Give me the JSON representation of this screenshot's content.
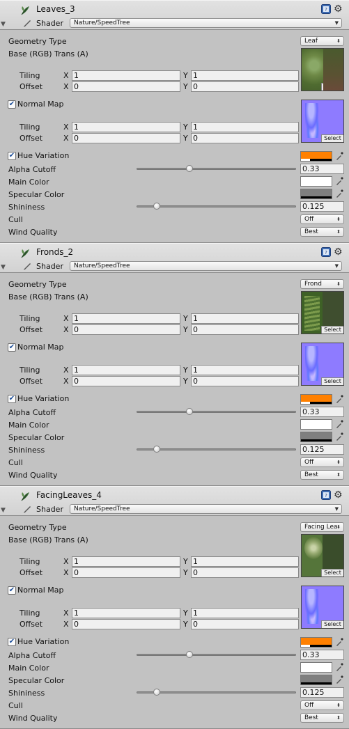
{
  "materials": [
    {
      "name": "Leaves_3",
      "shader_label": "Shader",
      "shader": "Nature/SpeedTree",
      "geometry_type_label": "Geometry Type",
      "geometry_type": "Leaf",
      "base_label": "Base (RGB) Trans (A)",
      "base_tiling": {
        "label": "Tiling",
        "x": "1",
        "y": "1"
      },
      "base_offset": {
        "label": "Offset",
        "x": "0",
        "y": "0"
      },
      "normal_map_label": "Normal Map",
      "normal_map_enabled": true,
      "normal_tiling": {
        "label": "Tiling",
        "x": "1",
        "y": "1"
      },
      "normal_offset": {
        "label": "Offset",
        "x": "0",
        "y": "0"
      },
      "hue_variation_label": "Hue Variation",
      "hue_variation_enabled": true,
      "hue_color": "#ff8000",
      "alpha_cutoff_label": "Alpha Cutoff",
      "alpha_cutoff": "0.33",
      "main_color_label": "Main Color",
      "main_color": "#ffffff",
      "specular_color_label": "Specular Color",
      "specular_color": "#7f7f7f",
      "shininess_label": "Shininess",
      "shininess": "0.125",
      "cull_label": "Cull",
      "cull": "Off",
      "wind_quality_label": "Wind Quality",
      "wind_quality": "Best",
      "select_label": "Select",
      "icons": {
        "material": "speedtree-leaf-icon",
        "help": "help-book-icon",
        "settings": "gear-icon",
        "shader": "pen-icon",
        "picker": "eyedropper-icon"
      }
    },
    {
      "name": "Fronds_2",
      "shader_label": "Shader",
      "shader": "Nature/SpeedTree",
      "geometry_type_label": "Geometry Type",
      "geometry_type": "Frond",
      "base_label": "Base (RGB) Trans (A)",
      "base_tiling": {
        "label": "Tiling",
        "x": "1",
        "y": "1"
      },
      "base_offset": {
        "label": "Offset",
        "x": "0",
        "y": "0"
      },
      "normal_map_label": "Normal Map",
      "normal_map_enabled": true,
      "normal_tiling": {
        "label": "Tiling",
        "x": "1",
        "y": "1"
      },
      "normal_offset": {
        "label": "Offset",
        "x": "0",
        "y": "0"
      },
      "hue_variation_label": "Hue Variation",
      "hue_variation_enabled": true,
      "hue_color": "#ff8000",
      "alpha_cutoff_label": "Alpha Cutoff",
      "alpha_cutoff": "0.33",
      "main_color_label": "Main Color",
      "main_color": "#ffffff",
      "specular_color_label": "Specular Color",
      "specular_color": "#7f7f7f",
      "shininess_label": "Shininess",
      "shininess": "0.125",
      "cull_label": "Cull",
      "cull": "Off",
      "wind_quality_label": "Wind Quality",
      "wind_quality": "Best",
      "select_label": "Select",
      "icons": {
        "material": "speedtree-leaf-icon",
        "help": "help-book-icon",
        "settings": "gear-icon",
        "shader": "pen-icon",
        "picker": "eyedropper-icon"
      }
    },
    {
      "name": "FacingLeaves_4",
      "shader_label": "Shader",
      "shader": "Nature/SpeedTree",
      "geometry_type_label": "Geometry Type",
      "geometry_type": "Facing Lea",
      "base_label": "Base (RGB) Trans (A)",
      "base_tiling": {
        "label": "Tiling",
        "x": "1",
        "y": "1"
      },
      "base_offset": {
        "label": "Offset",
        "x": "0",
        "y": "0"
      },
      "normal_map_label": "Normal Map",
      "normal_map_enabled": true,
      "normal_tiling": {
        "label": "Tiling",
        "x": "1",
        "y": "1"
      },
      "normal_offset": {
        "label": "Offset",
        "x": "0",
        "y": "0"
      },
      "hue_variation_label": "Hue Variation",
      "hue_variation_enabled": true,
      "hue_color": "#ff8000",
      "alpha_cutoff_label": "Alpha Cutoff",
      "alpha_cutoff": "0.33",
      "main_color_label": "Main Color",
      "main_color": "#ffffff",
      "specular_color_label": "Specular Color",
      "specular_color": "#7f7f7f",
      "shininess_label": "Shininess",
      "shininess": "0.125",
      "cull_label": "Cull",
      "cull": "Off",
      "wind_quality_label": "Wind Quality",
      "wind_quality": "Best",
      "select_label": "Select",
      "icons": {
        "material": "speedtree-leaf-icon",
        "help": "help-book-icon",
        "settings": "gear-icon",
        "shader": "pen-icon",
        "picker": "eyedropper-icon"
      }
    }
  ],
  "axis_labels": {
    "x": "X",
    "y": "Y"
  },
  "slider_levels": {
    "alpha_cutoff": 0.33,
    "shininess": 0.125
  }
}
